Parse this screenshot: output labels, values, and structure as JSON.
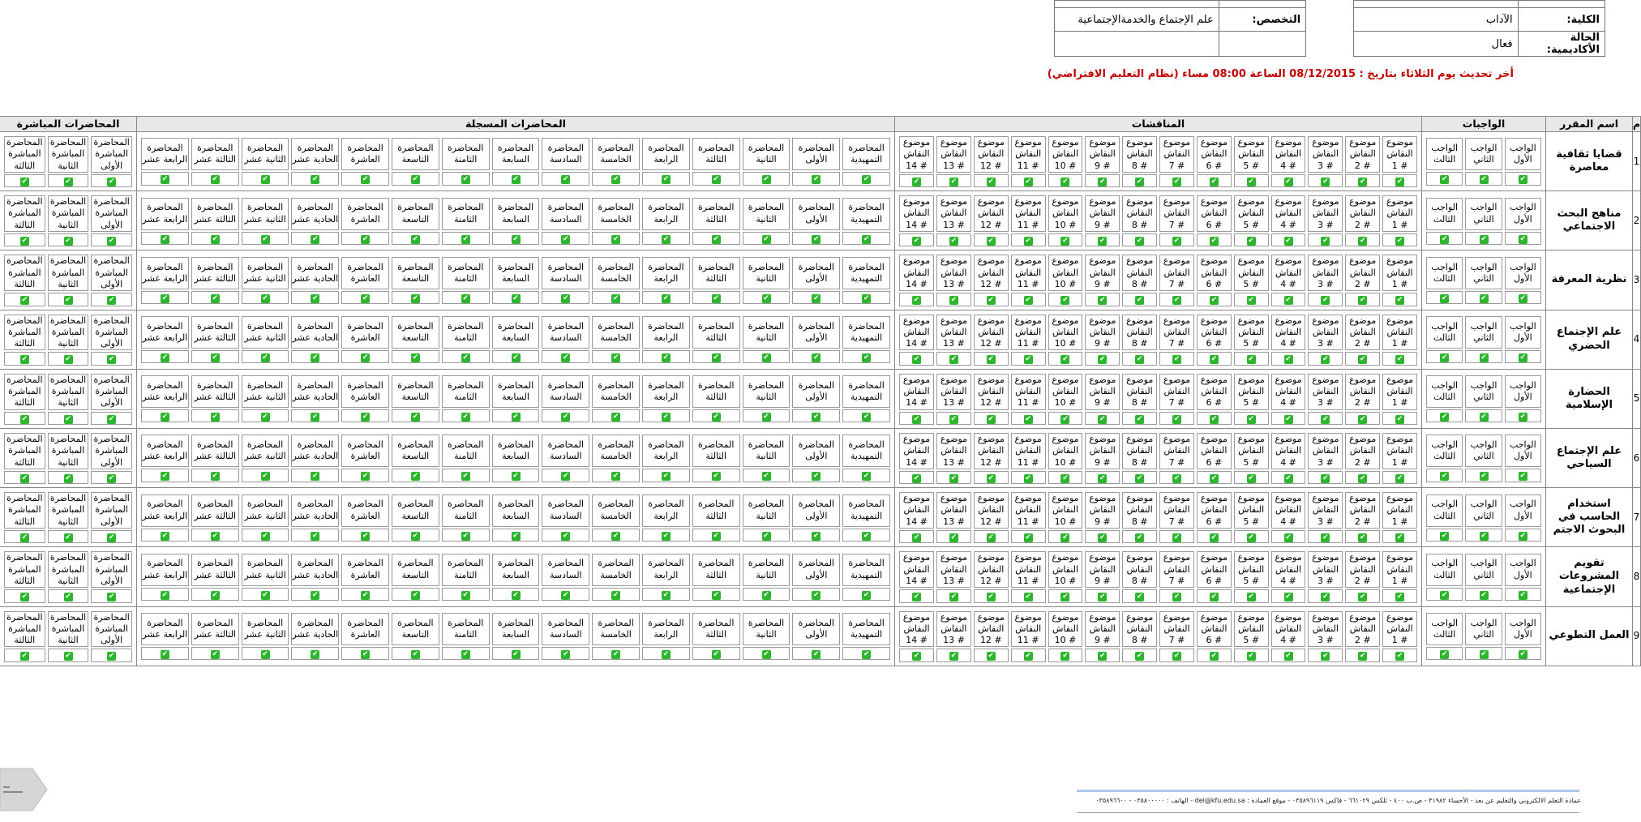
{
  "header": {
    "row0": {
      "a": "",
      "b": "",
      "c": "",
      "d": ""
    },
    "row1": {
      "college_label": "الكلية:",
      "college": "الآداب",
      "major_label": "التخصص:",
      "major": "علم الإجتماع والخدمةالإجتماعية"
    },
    "row2": {
      "status_label": "الحالة الأكاديمية:",
      "status": "فعال"
    }
  },
  "update_note": "أخر تحديث يوم الثلاثاء بتاريخ : 08/12/2015 الساعة 08:00 مساء (نظام التعليم الافتراضي)",
  "columns": {
    "num": "م",
    "course": "اسم المقرر",
    "assignments": "الواجبات",
    "discussions": "المناقشات",
    "recorded": "المحاضرات المسجلة",
    "live": "المحاضرات المباشرة"
  },
  "assignments": [
    "الواجب الأول",
    "الواجب الثاني",
    "الواجب الثالث"
  ],
  "discussions": [
    "موضوع النقاش # 1",
    "موضوع النقاش # 2",
    "موضوع النقاش # 3",
    "موضوع النقاش # 4",
    "موضوع النقاش # 5",
    "موضوع النقاش # 6",
    "موضوع النقاش # 7",
    "موضوع النقاش # 8",
    "موضوع النقاش # 9",
    "موضوع النقاش # 10",
    "موضوع النقاش # 11",
    "موضوع النقاش # 12",
    "موضوع النقاش # 13",
    "موضوع النقاش # 14"
  ],
  "recorded": [
    "المحاضرة التمهيدية",
    "المحاضرة الأولى",
    "المحاضرة الثانية",
    "المحاضرة الثالثة",
    "المحاضرة الرابعة",
    "المحاضرة الخامسة",
    "المحاضرة السادسة",
    "المحاضرة السابعة",
    "المحاضرة الثامنة",
    "المحاضرة التاسعة",
    "المحاضرة العاشرة",
    "المحاضرة الحادية عشر",
    "المحاضرة الثانية عشر",
    "المحاضرة الثالثة عشر",
    "المحاضرة الرابعة عشر"
  ],
  "live": [
    "المحاضرة المباشرة الأولى",
    "المحاضرة المباشرة الثانية",
    "المحاضرة المباشرة الثالثة"
  ],
  "check_glyph": "✔",
  "courses": [
    {
      "num": "1",
      "name": "قضايا ثقافية معاصرة"
    },
    {
      "num": "2",
      "name": "مناهج البحث الاجتماعي"
    },
    {
      "num": "3",
      "name": "نظرية المعرفة"
    },
    {
      "num": "4",
      "name": "علم الإجتماع الحضري"
    },
    {
      "num": "5",
      "name": "الحضارة الإسلامية"
    },
    {
      "num": "6",
      "name": "علم الإجتماع السياحي"
    },
    {
      "num": "7",
      "name": "استخدام الحاسب في البحوث الاجتم"
    },
    {
      "num": "8",
      "name": "تقويم المشروعات الإجتماعية"
    },
    {
      "num": "9",
      "name": "العمل التطوعي"
    }
  ],
  "footer": "عمادة التعلم الالكتروني والتعليم عن بعد - الأحساء ٣١٩٨٢ - ص.ب ٤٠٠ - تلكس ٦٦١٠٢٩ - فاكس ٠٣٥٨٩٦١١٩ - موقع العمادة : del@kfu.edu.sa - الهاتف : ٠٣٥٨٠٠٠٠٠ - ٠٣٥٨٩٦٦٠٠",
  "colors": {
    "check": "#2db52d",
    "note": "#c00000",
    "header_bg": "#e8e8e8"
  }
}
